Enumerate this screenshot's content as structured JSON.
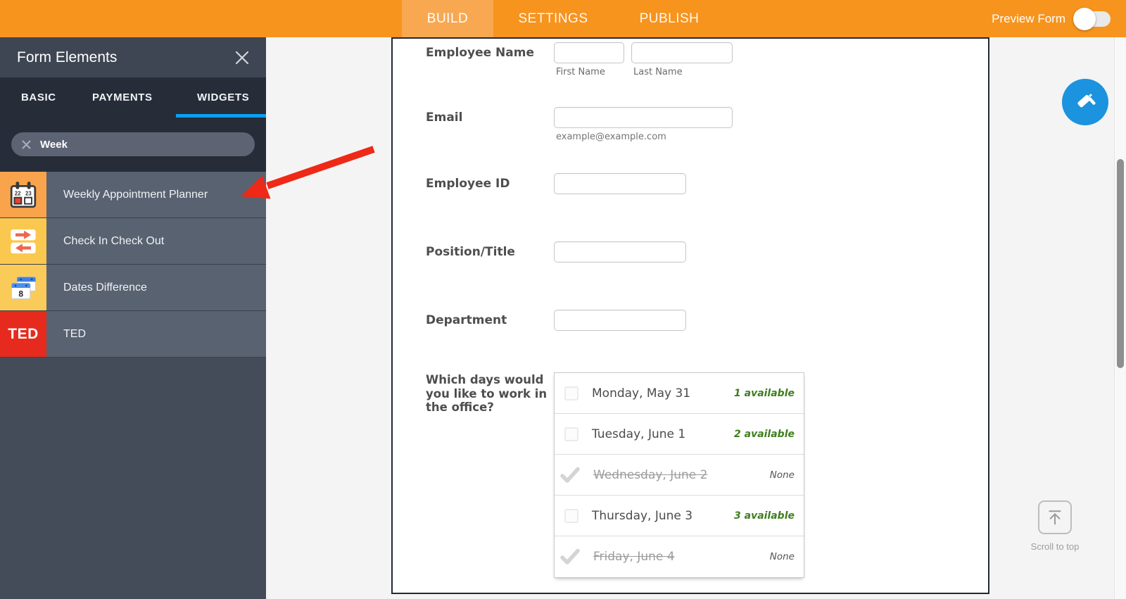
{
  "header": {
    "tabs": [
      {
        "label": "BUILD"
      },
      {
        "label": "SETTINGS"
      },
      {
        "label": "PUBLISH"
      }
    ],
    "active_tab": "BUILD",
    "preview_toggle_label": "Preview Form",
    "preview_toggle_state": "off"
  },
  "colors": {
    "header_orange": "#F7941E",
    "active_tab_orange": "#F8A851",
    "widgets_underline_blue": "#0D9DF2",
    "designer_button_blue": "#1B93DE",
    "annotation_arrow_red": "#EE2917",
    "available_green": "#3E7E1E",
    "ted_red": "#E62B1E"
  },
  "sidebar": {
    "title": "Form Elements",
    "tabs": [
      {
        "label": "BASIC"
      },
      {
        "label": "PAYMENTS"
      },
      {
        "label": "WIDGETS"
      }
    ],
    "active_tab": "WIDGETS",
    "search": {
      "value": "Week"
    },
    "widgets": [
      {
        "label": "Weekly Appointment Planner",
        "icon": "weekly-appointment-planner-calendar-icon",
        "cal_day_left": "22",
        "cal_day_right": "23"
      },
      {
        "label": "Check In Check Out",
        "icon": "check-in-check-out-arrows-icon"
      },
      {
        "label": "Dates Difference",
        "icon": "dates-difference-calendars-icon",
        "cal_number": "8"
      },
      {
        "label": "TED",
        "icon": "ted-logo-icon",
        "logo_text": "TED"
      }
    ]
  },
  "form": {
    "name_field": {
      "label": "Employee Name",
      "first_sublabel": "First Name",
      "last_sublabel": "Last Name",
      "first_value": "",
      "last_value": ""
    },
    "email_field": {
      "label": "Email",
      "hint": "example@example.com",
      "value": ""
    },
    "text_fields": [
      {
        "label": "Employee ID",
        "value": ""
      },
      {
        "label": "Position/Title",
        "value": ""
      },
      {
        "label": "Department",
        "value": ""
      }
    ],
    "days_field": {
      "label": "Which days would you like to work in the office?",
      "options": [
        {
          "day": "Monday, May 31",
          "availability": "1 available",
          "unavailable": false
        },
        {
          "day": "Tuesday, June 1",
          "availability": "2 available",
          "unavailable": false
        },
        {
          "day": "Wednesday, June 2",
          "availability": "None",
          "unavailable": true
        },
        {
          "day": "Thursday, June 3",
          "availability": "3 available",
          "unavailable": false
        },
        {
          "day": "Friday, June 4",
          "availability": "None",
          "unavailable": true
        }
      ]
    }
  },
  "right_rail": {
    "scroll_to_top_label": "Scroll to top"
  }
}
